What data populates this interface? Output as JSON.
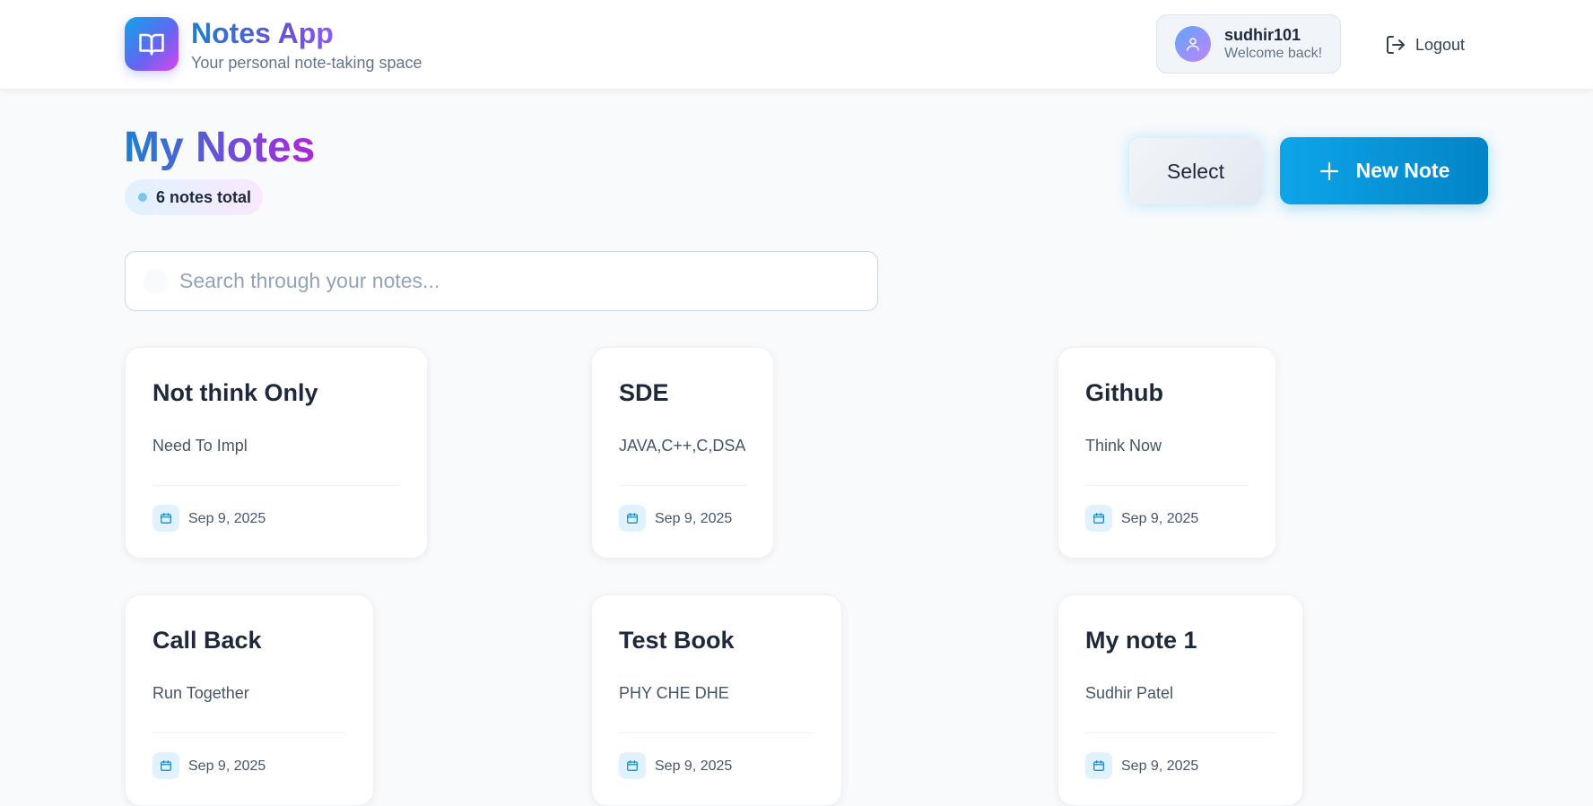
{
  "header": {
    "app_title": "Notes App",
    "app_subtitle": "Your personal note-taking space",
    "logo_icon": "book-open-icon",
    "user": {
      "name": "sudhir101",
      "welcome": "Welcome back!",
      "avatar_icon": "user-icon"
    },
    "logout_label": "Logout",
    "logout_icon": "logout-icon"
  },
  "page": {
    "title": "My Notes",
    "count_label": "6 notes total",
    "select_label": "Select",
    "new_note_label": "New Note"
  },
  "search": {
    "placeholder": "Search through your notes...",
    "value": ""
  },
  "notes": [
    {
      "title": "Not think Only",
      "body": "Need To Impl",
      "date": "Sep 9, 2025"
    },
    {
      "title": "SDE",
      "body": "JAVA,C++,C,DSA",
      "date": "Sep 9, 2025"
    },
    {
      "title": "Github",
      "body": "Think Now",
      "date": "Sep 9, 2025"
    },
    {
      "title": "Call Back",
      "body": "Run Together",
      "date": "Sep 9, 2025"
    },
    {
      "title": "Test Book",
      "body": "PHY CHE DHE",
      "date": "Sep 9, 2025"
    },
    {
      "title": "My note 1",
      "body": "Sudhir Patel",
      "date": "Sep 9, 2025"
    }
  ],
  "colors": {
    "accent": "#0ea5e9",
    "accent_dark": "#0284c7",
    "title_gradient_start": "#1d7fd1",
    "title_gradient_end": "#b026d9",
    "background": "#f8fafc"
  }
}
